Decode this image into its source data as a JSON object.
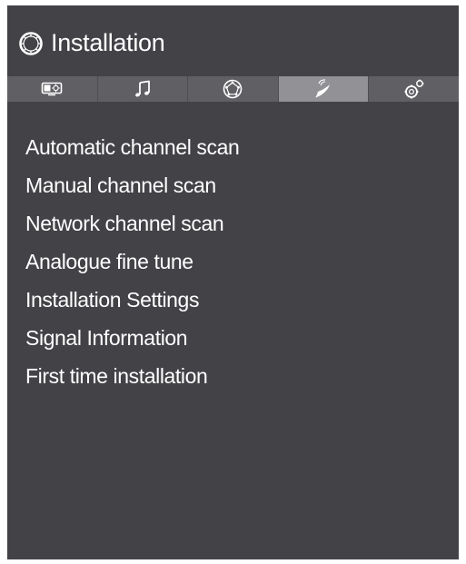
{
  "header": {
    "title": "Installation",
    "icon": "gear-ring-icon"
  },
  "tabs": [
    {
      "icon": "picture-icon",
      "active": false
    },
    {
      "icon": "music-note-icon",
      "active": false
    },
    {
      "icon": "globe-network-icon",
      "active": false
    },
    {
      "icon": "satellite-dish-icon",
      "active": true
    },
    {
      "icon": "settings-gear-icon",
      "active": false
    }
  ],
  "menu": {
    "items": [
      "Automatic channel scan",
      "Manual channel scan",
      "Network channel scan",
      "Analogue fine tune",
      "Installation Settings",
      "Signal Information",
      "First time installation"
    ]
  },
  "colors": {
    "panel_bg": "#434247",
    "tab_bar_bg": "#605f64",
    "tab_active_bg": "#929196",
    "text": "#ffffff"
  }
}
